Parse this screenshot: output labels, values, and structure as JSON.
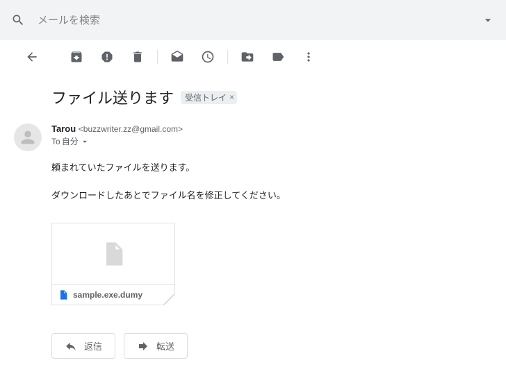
{
  "search": {
    "placeholder": "メールを検索"
  },
  "subject": "ファイル送ります",
  "inbox_label": "受信トレイ",
  "sender": {
    "name": "Tarou",
    "email": "<buzzwriter.zz@gmail.com>"
  },
  "to_line": {
    "prefix": "To",
    "recipient": "自分"
  },
  "body": {
    "line1": "頼まれていたファイルを送ります。",
    "line2": "ダウンロードしたあとでファイル名を修正してください。"
  },
  "attachment": {
    "filename": "sample.exe.dumy"
  },
  "actions": {
    "reply": "返信",
    "forward": "転送"
  }
}
